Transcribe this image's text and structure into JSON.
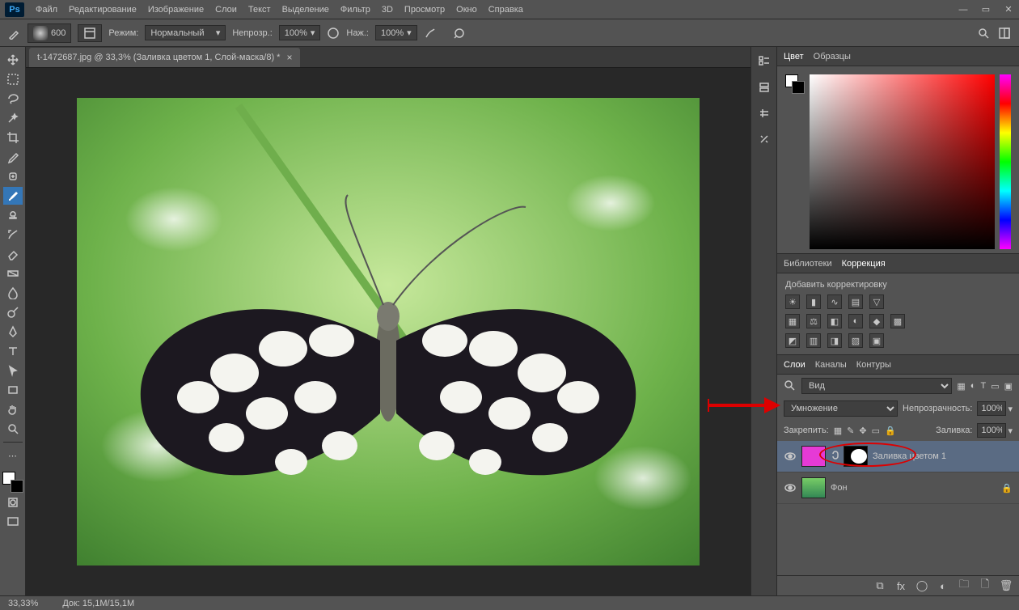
{
  "app": {
    "logo": "Ps"
  },
  "menu": [
    "Файл",
    "Редактирование",
    "Изображение",
    "Слои",
    "Текст",
    "Выделение",
    "Фильтр",
    "3D",
    "Просмотр",
    "Окно",
    "Справка"
  ],
  "options": {
    "brush_size": "600",
    "mode_label": "Режим:",
    "mode_value": "Нормальный",
    "opacity_label": "Непрозр.:",
    "opacity_value": "100%",
    "flow_label": "Наж.:",
    "flow_value": "100%"
  },
  "tab": {
    "title": "t-1472687.jpg @ 33,3% (Заливка цветом 1, Слой-маска/8) *"
  },
  "panels": {
    "color_tab": "Цвет",
    "swatches_tab": "Образцы",
    "libraries_tab": "Библиотеки",
    "adjustments_tab": "Коррекция",
    "adjust_label": "Добавить корректировку",
    "layers_tab": "Слои",
    "channels_tab": "Каналы",
    "paths_tab": "Контуры"
  },
  "layers": {
    "kind_label": "Вид",
    "blend_mode": "Умножение",
    "opacity_label": "Непрозрачность:",
    "opacity_value": "100%",
    "lock_label": "Закрепить:",
    "fill_label": "Заливка:",
    "fill_value": "100%",
    "items": [
      {
        "name": "Заливка цветом 1",
        "fill_color": "#e63ad6",
        "selected": true,
        "has_mask": true
      },
      {
        "name": "Фон",
        "selected": false,
        "thumb": "image",
        "locked": true
      }
    ]
  },
  "status": {
    "zoom": "33,33%",
    "doc": "Док: 15,1М/15,1М"
  }
}
